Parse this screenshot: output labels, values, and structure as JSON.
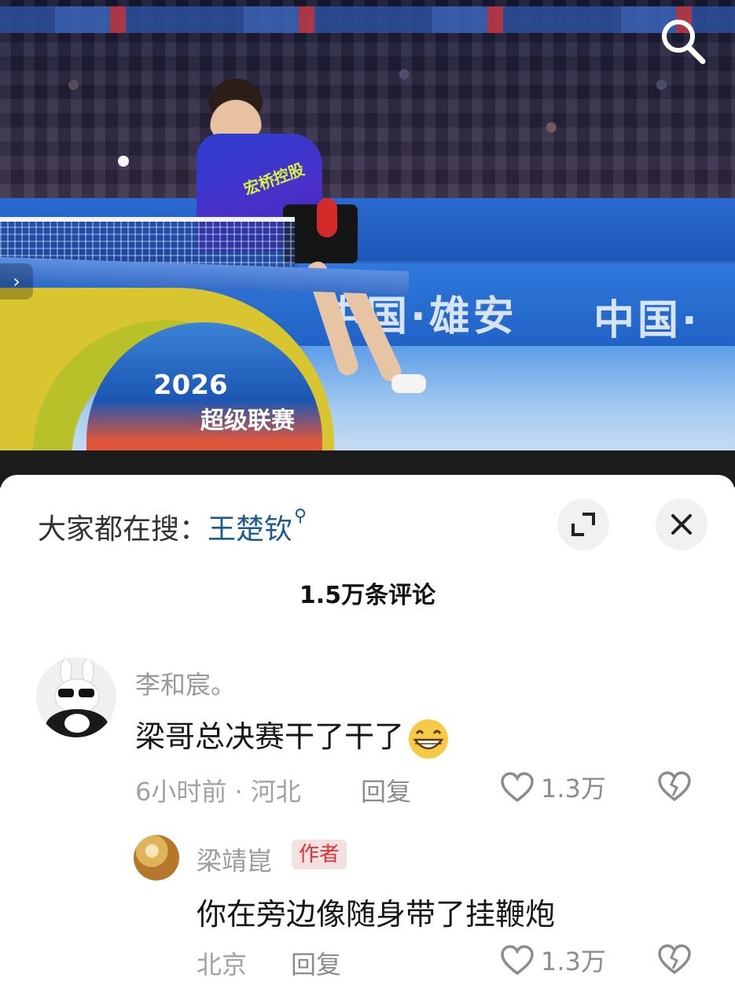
{
  "photo": {
    "ad_text_1": "中国·雄安",
    "ad_text_2": "中国·",
    "table_brand": "2026",
    "table_event": "超级联赛",
    "shirt_sponsor": "宏桥控股"
  },
  "search_icon": "search-icon",
  "trend": {
    "prefix": "大家都在搜：",
    "keyword": "王楚钦",
    "keyword_icon": "search-icon"
  },
  "controls": {
    "expand_icon": "expand-icon",
    "close_icon": "close-icon"
  },
  "comments_count": "1.5万条评论",
  "comments": [
    {
      "author": "李和宸。",
      "text": "梁哥总决赛干了干了",
      "emoji": "grinning-face-emoji",
      "time": "6小时前 · 河北",
      "reply_label": "回复",
      "likes": "1.3万"
    }
  ],
  "reply": {
    "author": "梁靖崑",
    "badge": "作者",
    "text": "你在旁边像随身带了挂鞭炮",
    "location": "北京",
    "reply_label": "回复",
    "likes": "1.3万"
  }
}
